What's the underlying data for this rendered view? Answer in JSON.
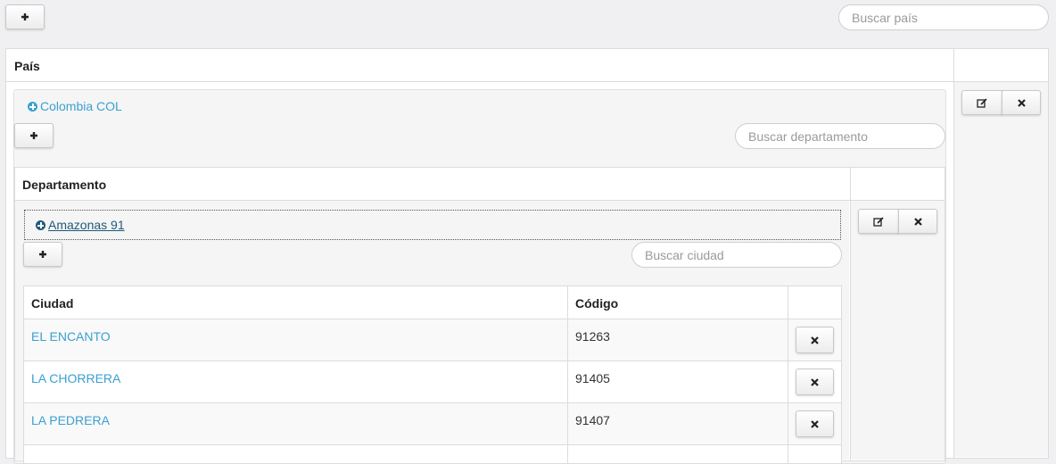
{
  "top": {
    "add_label": "+",
    "search_placeholder": "Buscar país"
  },
  "country_table": {
    "header": "País",
    "country": {
      "name": "Colombia COL",
      "expand_icon": "plus-circle-icon"
    },
    "actions": {
      "edit_icon": "edit-icon",
      "delete_icon": "close-icon"
    }
  },
  "department_section": {
    "add_label": "+",
    "search_placeholder": "Buscar departamento",
    "header": "Departamento",
    "department": {
      "name": "Amazonas 91",
      "expand_icon": "plus-circle-icon"
    },
    "actions": {
      "edit_icon": "edit-icon",
      "delete_icon": "close-icon"
    }
  },
  "city_section": {
    "add_label": "+",
    "search_placeholder": "Buscar ciudad",
    "columns": [
      "Ciudad",
      "Código",
      ""
    ],
    "rows": [
      {
        "city": "EL ENCANTO",
        "code": "91263"
      },
      {
        "city": "LA CHORRERA",
        "code": "91405"
      },
      {
        "city": "LA PEDRERA",
        "code": "91407"
      }
    ]
  },
  "colors": {
    "link": "#3aa0cf",
    "link_dark": "#1f5a7a",
    "background": "#f0f0f3"
  }
}
